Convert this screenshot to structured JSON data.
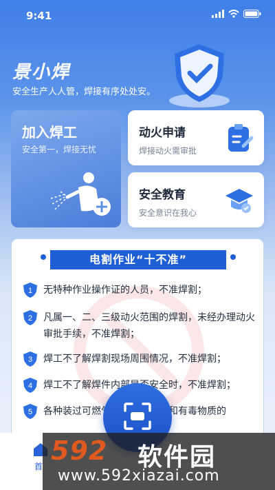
{
  "status_bar": {
    "time": "9:41"
  },
  "header": {
    "brand": "景小焊",
    "slogan": "安全生产人人管，焊接有序处处安。"
  },
  "cards": {
    "join": {
      "title": "加入焊工",
      "subtitle": "安全第一，焊接无忧"
    },
    "fire": {
      "title": "动火申请",
      "subtitle": "焊接动火需审批"
    },
    "education": {
      "title": "安全教育",
      "subtitle": "安全意识在我心"
    }
  },
  "rules": {
    "title": "电割作业“十不准”",
    "items": [
      {
        "num": "1",
        "text": "无特种作业操作证的人员，不准焊割；"
      },
      {
        "num": "2",
        "text": "凡属一、二、三级动火范围的焊割，未经办理动火审批手续，不准焊割；"
      },
      {
        "num": "3",
        "text": "焊工不了解焊割现场周围情况，不准焊割；"
      },
      {
        "num": "4",
        "text": "焊工不了解焊件内部是否安全时，不准焊割；"
      },
      {
        "num": "5",
        "text": "各种装过可燃气体、易燃液体和有毒物质的"
      }
    ]
  },
  "tabbar": {
    "home": "首"
  },
  "watermark": {
    "logo": "592",
    "name": "软件园",
    "url": "www.592xiazai.com"
  },
  "colors": {
    "primary": "#1f5fd6",
    "accent": "#e05a20"
  }
}
